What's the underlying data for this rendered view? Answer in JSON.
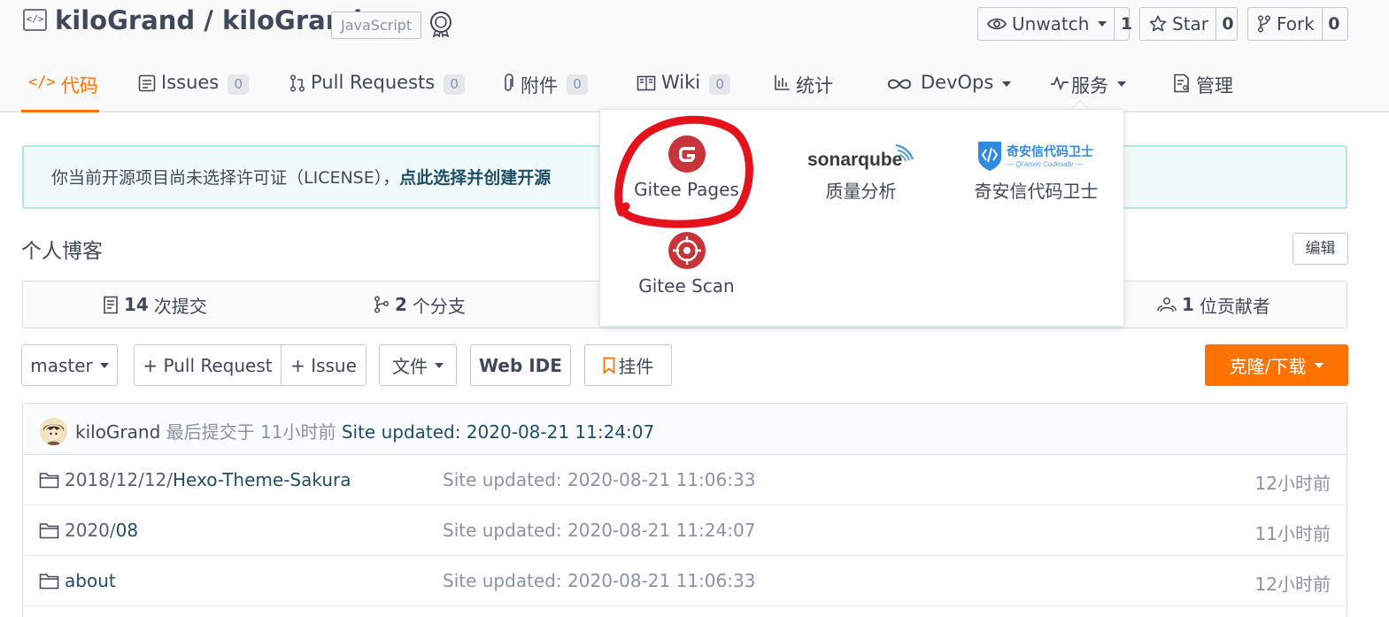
{
  "repo": {
    "owner": "kiloGrand",
    "separator": " / ",
    "name": "kiloGrand",
    "title": "kiloGrand / kiloGrand",
    "language": "JavaScript",
    "icon": "code-icon"
  },
  "header_buttons": {
    "unwatch": {
      "label": "Unwatch",
      "count": "1",
      "icon": "eye-icon"
    },
    "star": {
      "label": "Star",
      "count": "0",
      "icon": "star-icon"
    },
    "fork": {
      "label": "Fork",
      "count": "0",
      "icon": "fork-icon"
    }
  },
  "tabs": [
    {
      "label": "代码",
      "icon": "code-icon",
      "active": true
    },
    {
      "label": "Issues",
      "badge": "0",
      "icon": "issues-icon"
    },
    {
      "label": "Pull Requests",
      "badge": "0",
      "icon": "pull-request-icon"
    },
    {
      "label": "附件",
      "badge": "0",
      "icon": "paperclip-icon"
    },
    {
      "label": "Wiki",
      "badge": "0",
      "icon": "book-icon"
    },
    {
      "label": "统计",
      "icon": "bar-chart-icon"
    },
    {
      "label": "DevOps",
      "icon": "infinity-icon"
    },
    {
      "label": "服务",
      "icon": "pulse-icon"
    },
    {
      "label": "管理",
      "icon": "settings-doc-icon"
    }
  ],
  "license_banner": {
    "text": "你当前开源项目尚未选择许可证（LICENSE），",
    "link": "点此选择并创建开源"
  },
  "description": "个人博客",
  "edit_label": "编辑",
  "stats": {
    "commits": {
      "count": "14",
      "label": "次提交"
    },
    "branches": {
      "count": "2",
      "label": "个分支"
    },
    "contributors": {
      "count": "1",
      "label": "位贡献者"
    }
  },
  "toolbar": {
    "branch": "master",
    "pull_request": "+ Pull Request",
    "issue": "+ Issue",
    "file": "文件",
    "web_ide": "Web IDE",
    "widget": "挂件",
    "clone": "克隆/下载"
  },
  "last_commit": {
    "author": "kiloGrand",
    "meta": "最后提交于 11小时前",
    "message": "Site updated: 2020-08-21 11:24:07"
  },
  "files": [
    {
      "dir": "2018/12/12/",
      "name": "Hexo-Theme-Sakura",
      "message": "Site updated: 2020-08-21 11:06:33",
      "time": "12小时前"
    },
    {
      "dir": "2020/",
      "name": "08",
      "message": "Site updated: 2020-08-21 11:24:07",
      "time": "11小时前"
    },
    {
      "dir": "",
      "name": "about",
      "message": "Site updated: 2020-08-21 11:06:33",
      "time": "12小时前"
    }
  ],
  "services_menu": [
    {
      "label": "Gitee Pages",
      "icon": "gitee-logo-icon"
    },
    {
      "label": "质量分析",
      "logo_text": "sonarqube",
      "icon": "sonarqube-logo-icon"
    },
    {
      "label": "奇安信代码卫士",
      "logo_text": "奇安信代码卫士",
      "logo_subtext": "— Qi'anxin Codesafe —",
      "icon": "qianxin-logo-icon"
    },
    {
      "label": "Gitee Scan",
      "icon": "gitee-scan-icon"
    }
  ],
  "colors": {
    "accent": "#fe7300",
    "link": "#1e4e68",
    "muted": "#8c92a4",
    "gitee_red": "#c7353a",
    "annotation_red": "#e3121b"
  }
}
